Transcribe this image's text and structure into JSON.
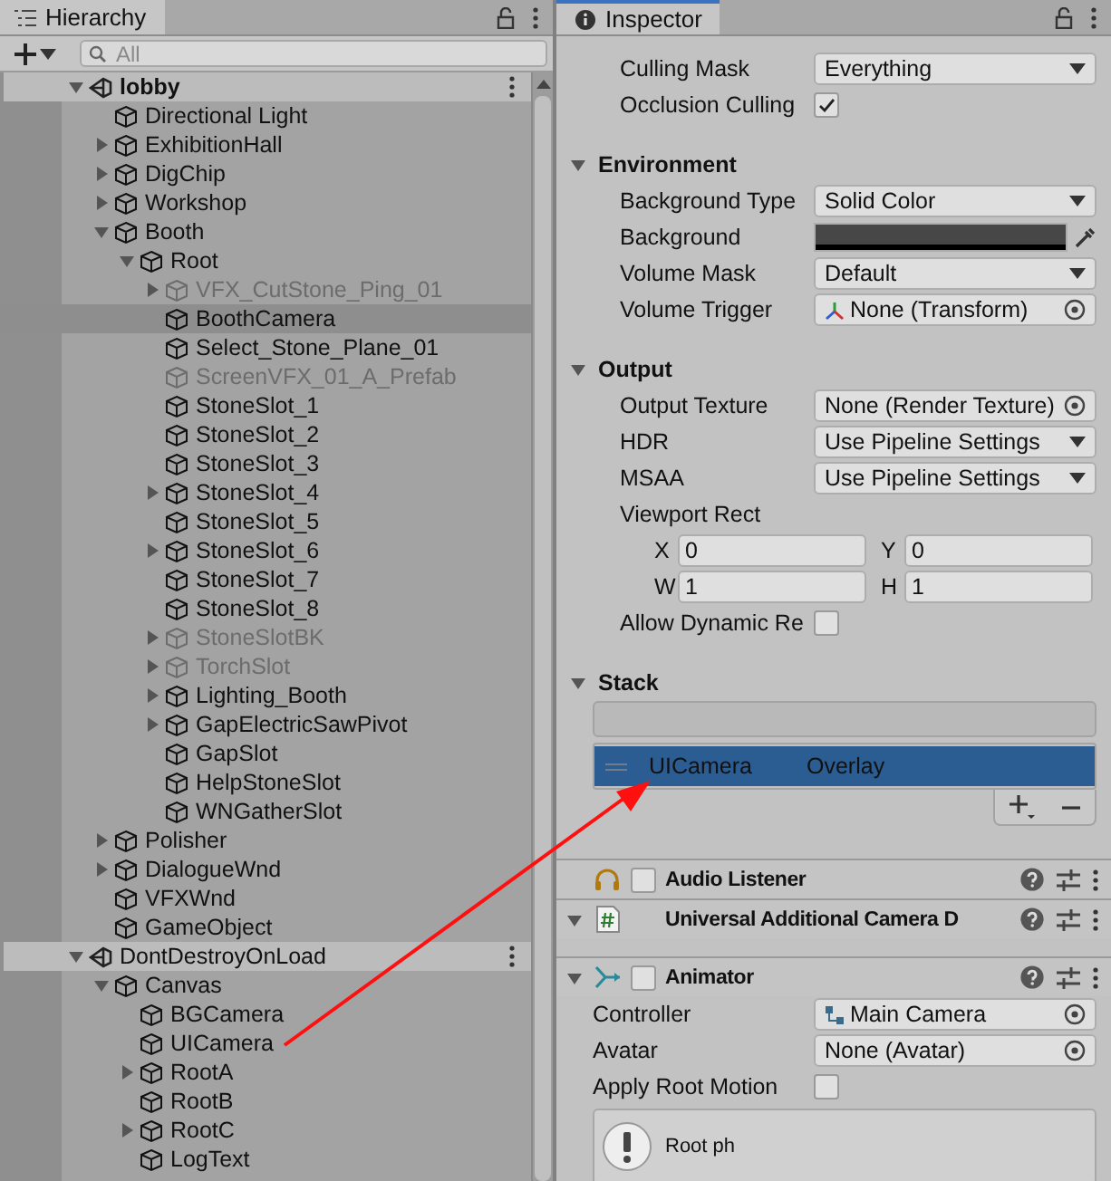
{
  "hierarchy": {
    "title": "Hierarchy",
    "search": {
      "placeholder": "All"
    },
    "tree": [
      {
        "kind": "scene",
        "name": "lobby",
        "expanded": true,
        "selected": false,
        "inactive": false,
        "active_scene": true,
        "children": [
          {
            "kind": "object",
            "name": "Directional Light",
            "selected": false,
            "inactive": false
          },
          {
            "kind": "group",
            "name": "ExhibitionHall",
            "expanded": false,
            "selected": false,
            "inactive": false
          },
          {
            "kind": "group",
            "name": "DigChip",
            "expanded": false,
            "selected": false,
            "inactive": false
          },
          {
            "kind": "group",
            "name": "Workshop",
            "expanded": false,
            "selected": false,
            "inactive": false
          },
          {
            "kind": "group",
            "name": "Booth",
            "expanded": true,
            "selected": false,
            "inactive": false,
            "children": [
              {
                "kind": "group",
                "name": "Root",
                "expanded": true,
                "selected": false,
                "inactive": false,
                "children": [
                  {
                    "kind": "group",
                    "name": "VFX_CutStone_Ping_01",
                    "expanded": false,
                    "selected": false,
                    "inactive": true
                  },
                  {
                    "kind": "object",
                    "name": "BoothCamera",
                    "selected": true,
                    "inactive": false
                  },
                  {
                    "kind": "object",
                    "name": "Select_Stone_Plane_01",
                    "selected": false,
                    "inactive": false
                  },
                  {
                    "kind": "object",
                    "name": "ScreenVFX_01_A_Prefab",
                    "selected": false,
                    "inactive": true
                  },
                  {
                    "kind": "object",
                    "name": "StoneSlot_1",
                    "selected": false,
                    "inactive": false
                  },
                  {
                    "kind": "object",
                    "name": "StoneSlot_2",
                    "selected": false,
                    "inactive": false
                  },
                  {
                    "kind": "object",
                    "name": "StoneSlot_3",
                    "selected": false,
                    "inactive": false
                  },
                  {
                    "kind": "group",
                    "name": "StoneSlot_4",
                    "expanded": false,
                    "selected": false,
                    "inactive": false
                  },
                  {
                    "kind": "object",
                    "name": "StoneSlot_5",
                    "selected": false,
                    "inactive": false
                  },
                  {
                    "kind": "group",
                    "name": "StoneSlot_6",
                    "expanded": false,
                    "selected": false,
                    "inactive": false
                  },
                  {
                    "kind": "object",
                    "name": "StoneSlot_7",
                    "selected": false,
                    "inactive": false
                  },
                  {
                    "kind": "object",
                    "name": "StoneSlot_8",
                    "selected": false,
                    "inactive": false
                  },
                  {
                    "kind": "group",
                    "name": "StoneSlotBK",
                    "expanded": false,
                    "selected": false,
                    "inactive": true
                  },
                  {
                    "kind": "group",
                    "name": "TorchSlot",
                    "expanded": false,
                    "selected": false,
                    "inactive": true
                  },
                  {
                    "kind": "group",
                    "name": "Lighting_Booth",
                    "expanded": false,
                    "selected": false,
                    "inactive": false
                  },
                  {
                    "kind": "group",
                    "name": "GapElectricSawPivot",
                    "expanded": false,
                    "selected": false,
                    "inactive": false
                  },
                  {
                    "kind": "object",
                    "name": "GapSlot",
                    "selected": false,
                    "inactive": false
                  },
                  {
                    "kind": "object",
                    "name": "HelpStoneSlot",
                    "selected": false,
                    "inactive": false
                  },
                  {
                    "kind": "object",
                    "name": "WNGatherSlot",
                    "selected": false,
                    "inactive": false
                  }
                ]
              }
            ]
          },
          {
            "kind": "group",
            "name": "Polisher",
            "expanded": false,
            "selected": false,
            "inactive": false
          },
          {
            "kind": "group",
            "name": "DialogueWnd",
            "expanded": false,
            "selected": false,
            "inactive": false
          },
          {
            "kind": "object",
            "name": "VFXWnd",
            "selected": false,
            "inactive": false
          },
          {
            "kind": "object",
            "name": "GameObject",
            "selected": false,
            "inactive": false
          }
        ]
      },
      {
        "kind": "scene",
        "name": "DontDestroyOnLoad",
        "expanded": true,
        "selected": false,
        "inactive": false,
        "active_scene": false,
        "children": [
          {
            "kind": "group",
            "name": "Canvas",
            "expanded": true,
            "selected": false,
            "inactive": false,
            "children": [
              {
                "kind": "object",
                "name": "BGCamera",
                "selected": false,
                "inactive": false
              },
              {
                "kind": "object",
                "name": "UICamera",
                "selected": false,
                "inactive": false
              },
              {
                "kind": "group",
                "name": "RootA",
                "expanded": false,
                "selected": false,
                "inactive": false
              },
              {
                "kind": "object",
                "name": "RootB",
                "selected": false,
                "inactive": false
              },
              {
                "kind": "group",
                "name": "RootC",
                "expanded": false,
                "selected": false,
                "inactive": false
              },
              {
                "kind": "object",
                "name": "LogText",
                "selected": false,
                "inactive": false
              }
            ]
          }
        ]
      }
    ]
  },
  "inspector": {
    "title": "Inspector",
    "camera_settings": [
      {
        "kind": "dropdown",
        "label": "Culling Mask",
        "value": "Everything"
      },
      {
        "kind": "checkbox",
        "label": "Occlusion Culling",
        "checked": true
      },
      {
        "kind": "section",
        "label": "Environment",
        "expanded": true
      },
      {
        "kind": "dropdown",
        "label": "Background Type",
        "value": "Solid Color"
      },
      {
        "kind": "color",
        "label": "Background",
        "color": "#474747"
      },
      {
        "kind": "dropdown",
        "label": "Volume Mask",
        "value": "Default"
      },
      {
        "kind": "transform_ref",
        "label": "Volume Trigger",
        "value": "None (Transform)"
      },
      {
        "kind": "section",
        "label": "Output",
        "expanded": true
      },
      {
        "kind": "object",
        "label": "Output Texture",
        "value": "None (Render Texture)"
      },
      {
        "kind": "dropdown",
        "label": "HDR",
        "value": "Use Pipeline Settings"
      },
      {
        "kind": "dropdown",
        "label": "MSAA",
        "value": "Use Pipeline Settings"
      },
      {
        "kind": "label",
        "label": "Viewport Rect"
      },
      {
        "kind": "pair",
        "fields": [
          {
            "label": "X",
            "value": "0"
          },
          {
            "label": "Y",
            "value": "0"
          }
        ]
      },
      {
        "kind": "pair",
        "fields": [
          {
            "label": "W",
            "value": "1"
          },
          {
            "label": "H",
            "value": "1"
          }
        ]
      },
      {
        "kind": "checkbox",
        "label": "Allow Dynamic Re",
        "checked": false
      },
      {
        "kind": "section",
        "label": "Stack",
        "expanded": true
      },
      {
        "kind": "stack",
        "items": [
          {
            "name": "UICamera",
            "type": "Overlay",
            "selected": true
          }
        ]
      }
    ],
    "components": [
      {
        "kind": "audio",
        "title": "Audio Listener",
        "enabled": false
      },
      {
        "kind": "script",
        "title": "Universal Additional Camera D",
        "expanded": true
      },
      {
        "kind": "animator",
        "title": "Animator",
        "expanded": true,
        "enabled": false,
        "fields": [
          {
            "kind": "controller_ref",
            "label": "Controller",
            "value": "Main Camera"
          },
          {
            "kind": "object",
            "label": "Avatar",
            "value": "None (Avatar)"
          },
          {
            "kind": "checkbox",
            "label": "Apply Root Motion",
            "checked": false
          }
        ],
        "help": "Root ph"
      }
    ]
  }
}
